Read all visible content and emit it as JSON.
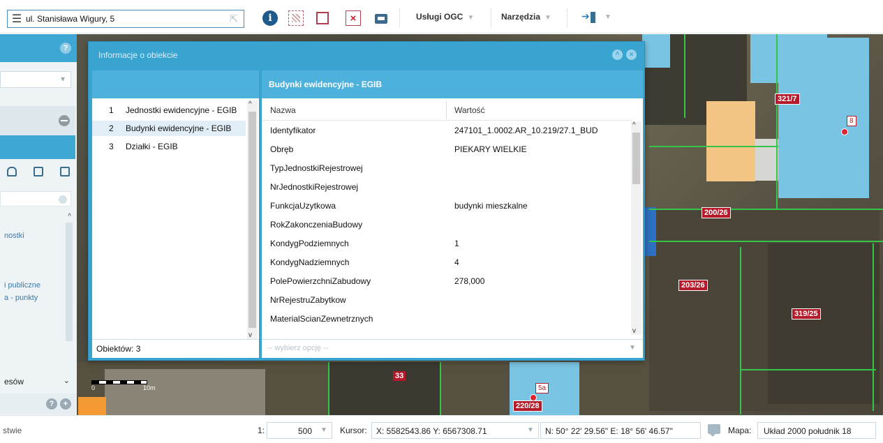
{
  "toolbar": {
    "address": "ul. Stanisława Wigury, 5",
    "menu_ogc": "Usługi OGC",
    "menu_tools": "Narzędzia"
  },
  "dialog": {
    "title": "Informacje o obiekcie",
    "objects": [
      {
        "num": "1",
        "label": "Jednostki ewidencyjne - EGIB"
      },
      {
        "num": "2",
        "label": "Budynki ewidencyjne - EGIB"
      },
      {
        "num": "3",
        "label": "Działki - EGIB"
      }
    ],
    "object_count": "Obiektów: 3",
    "right_title": "Budynki ewidencyjne - EGIB",
    "col_name": "Nazwa",
    "col_value": "Wartość",
    "attributes": [
      {
        "name": "Identyfikator",
        "value": "247101_1.0002.AR_10.219/27.1_BUD"
      },
      {
        "name": "Obręb",
        "value": "PIEKARY WIELKIE"
      },
      {
        "name": "TypJednostkiRejestrowej",
        "value": ""
      },
      {
        "name": "NrJednostkiRejestrowej",
        "value": ""
      },
      {
        "name": "FunkcjaUzytkowa",
        "value": "budynki mieszkalne"
      },
      {
        "name": "RokZakonczeniaBudowy",
        "value": ""
      },
      {
        "name": "KondygPodziemnych",
        "value": "1"
      },
      {
        "name": "KondygNadziemnych",
        "value": "4"
      },
      {
        "name": "PolePowierzchniZabudowy",
        "value": "278,000"
      },
      {
        "name": "NrRejestruZabytkow",
        "value": ""
      },
      {
        "name": "MaterialScianZewnetrznych",
        "value": ""
      }
    ],
    "option_placeholder": "-- wybierz opcję --"
  },
  "sidebar": {
    "items": [
      "nostki",
      "i publiczne",
      "a - punkty"
    ],
    "bottom_label": "esów"
  },
  "map": {
    "plots": [
      "321/7",
      "200/26",
      "203/26",
      "319/25",
      "220/28",
      "33"
    ],
    "houses": [
      "8",
      "5a"
    ],
    "scale_zero": "0",
    "scale_ten": "10m"
  },
  "status": {
    "left_text": "stwie",
    "scale_prefix": "1:",
    "scale_value": "500",
    "cursor_label": "Kursor:",
    "cursor_xy": "X: 5582543.86  Y: 6567308.71",
    "cursor_geo": "N: 50° 22' 29.56\"  E: 18° 56' 46.57\"",
    "map_label": "Mapa:",
    "crs": "Układ 2000 południk 18"
  },
  "colors": {
    "accent": "#3aa4d1",
    "building": "#79c4e2",
    "parcel_line": "#33c64a",
    "label_red": "#b51a2a"
  }
}
